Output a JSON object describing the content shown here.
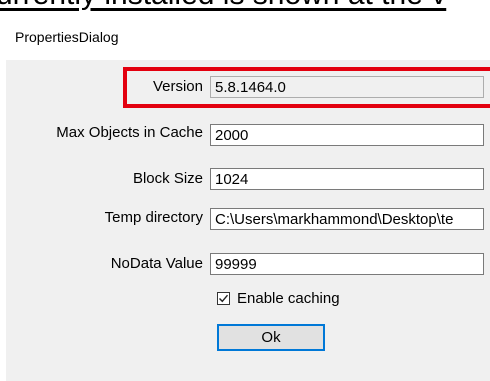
{
  "caption": "urrently installed is shown at the v",
  "window": {
    "title": "PropertiesDialog"
  },
  "fields": {
    "version": {
      "label": "Version",
      "value": "5.8.1464.0"
    },
    "max_objects": {
      "label": "Max Objects in Cache",
      "value": "2000"
    },
    "block_size": {
      "label": "Block Size",
      "value": "1024"
    },
    "temp_directory": {
      "label": "Temp directory",
      "value": "C:\\Users\\markhammond\\Desktop\\te"
    },
    "nodata_value": {
      "label": "NoData Value",
      "value": "99999"
    }
  },
  "enable_caching": {
    "label": "Enable caching",
    "checked": true
  },
  "ok_button": {
    "label": "Ok"
  },
  "colors": {
    "highlight": "#e3000f",
    "dialog_bg": "#f0f0f0",
    "button_focus": "#0078d7"
  }
}
